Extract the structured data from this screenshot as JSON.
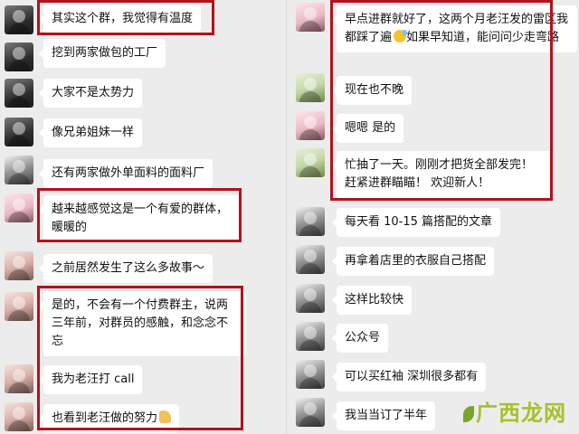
{
  "left_messages": [
    {
      "text": "其实这个群，我觉得有温度"
    },
    {
      "text": "挖到两家做包的工厂"
    },
    {
      "text": "大家不是太势力"
    },
    {
      "text": "像兄弟姐妹一样"
    },
    {
      "text": "还有两家做外单面料的面料厂"
    },
    {
      "text": "越来越感觉这是一个有爱的群体，暖暖的"
    },
    {
      "text": "之前居然发生了这么多故事～"
    },
    {
      "text": "是的，不会有一个付费群主，说两三年前，对群员的感触，和念念不忘"
    },
    {
      "text": "我为老汪打 call"
    },
    {
      "text": "也看到老汪做的努力"
    }
  ],
  "right_messages": [
    {
      "text": "早点进群就好了，这两个月老汪发的雷区我都踩了遍",
      "text_after_emoji": "如果早知道，能问问少走弯路"
    },
    {
      "text": "现在也不晚"
    },
    {
      "text": "嗯嗯 是的"
    },
    {
      "text": "忙抽了一天。刚刚才把货全部发完！ 赶紧进群瞄瞄！ 欢迎新人！"
    },
    {
      "text": "每天看 10-15 篇搭配的文章"
    },
    {
      "text": "再拿着店里的衣服自己搭配"
    },
    {
      "text": "这样比较快"
    },
    {
      "text": "公众号"
    },
    {
      "text": "可以买红袖  深圳很多都有"
    },
    {
      "text": "我当当订了半年"
    }
  ],
  "icons": {
    "sweat_emoji": "sweat-smile-emoji",
    "thumbs_up_emoji": "thumbs-up-emoji"
  },
  "watermark": {
    "text": "广西龙网"
  },
  "colors": {
    "highlight": "#b3121b",
    "background": "#ececec",
    "bubble": "#ffffff",
    "watermark": "#a8bf2e"
  }
}
